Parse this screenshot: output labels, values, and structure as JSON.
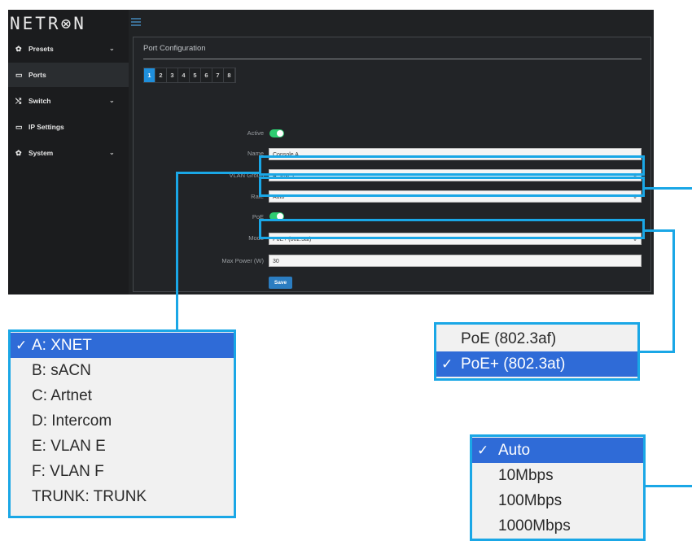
{
  "brand": {
    "logo_text": "NETR⊗N"
  },
  "sidebar": {
    "items": [
      {
        "label": "Presets",
        "icon": "gear-icon",
        "glyph": "✿",
        "has_chevron": true,
        "active": false
      },
      {
        "label": "Ports",
        "icon": "monitor-icon",
        "glyph": "▭",
        "has_chevron": false,
        "active": true
      },
      {
        "label": "Switch",
        "icon": "shuffle-icon",
        "glyph": "⤭",
        "has_chevron": true,
        "active": false
      },
      {
        "label": "IP Settings",
        "icon": "monitor-icon",
        "glyph": "▭",
        "has_chevron": false,
        "active": false
      },
      {
        "label": "System",
        "icon": "gear-icon",
        "glyph": "✿",
        "has_chevron": true,
        "active": false
      }
    ],
    "chevron": "⌄"
  },
  "panel": {
    "title": "Port Configuration",
    "ports": [
      "1",
      "2",
      "3",
      "4",
      "5",
      "6",
      "7",
      "8"
    ],
    "selected_port": "1"
  },
  "form": {
    "active_label": "Active",
    "active_on": true,
    "name_label": "Name",
    "name_value": "Console A",
    "vlan_label": "VLAN Group",
    "vlan_value": "A: XNET",
    "rate_label": "Rate",
    "rate_value": "Auto",
    "poe_label": "PoE",
    "poe_on": true,
    "mode_label": "Mode",
    "mode_value": "PoE+ (802.3at)",
    "maxpower_label": "Max Power (W)",
    "maxpower_value": "30",
    "save_label": "Save",
    "select_arrow": "⇕"
  },
  "callouts": {
    "check_glyph": "✓",
    "vlan_options": [
      {
        "label": "A:  XNET",
        "selected": true
      },
      {
        "label": "B:  sACN",
        "selected": false
      },
      {
        "label": "C:  Artnet",
        "selected": false
      },
      {
        "label": "D:  Intercom",
        "selected": false
      },
      {
        "label": "E:  VLAN E",
        "selected": false
      },
      {
        "label": "F:  VLAN F",
        "selected": false
      },
      {
        "label": "TRUNK:  TRUNK",
        "selected": false
      }
    ],
    "mode_options": [
      {
        "label": "PoE (802.3af)",
        "selected": false
      },
      {
        "label": "PoE+ (802.3at)",
        "selected": true
      }
    ],
    "rate_options": [
      {
        "label": "Auto",
        "selected": true
      },
      {
        "label": "10Mbps",
        "selected": false
      },
      {
        "label": "100Mbps",
        "selected": false
      },
      {
        "label": "1000Mbps",
        "selected": false
      }
    ]
  },
  "colors": {
    "accent": "#1aa7e6",
    "selected_port": "#1f8fdc",
    "toggle_on": "#2ecc71",
    "option_selected": "#2f6bd7",
    "save_button": "#2b7dc1"
  }
}
